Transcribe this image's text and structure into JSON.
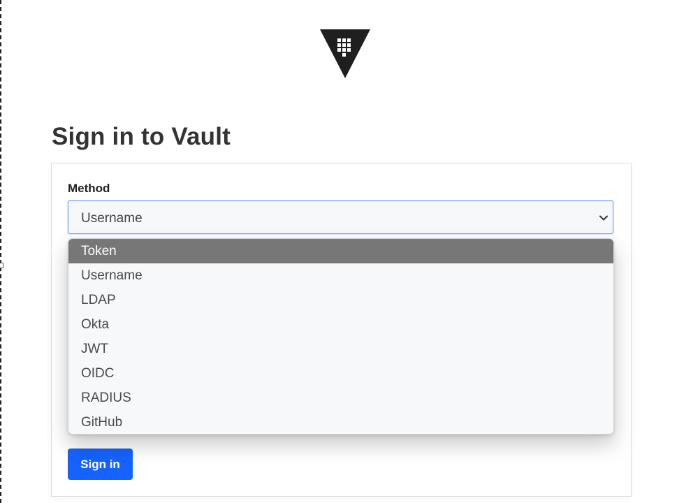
{
  "logo": {
    "icon": "vault-logo-icon",
    "color": "#1f1f1f"
  },
  "page": {
    "title": "Sign in to Vault"
  },
  "form": {
    "method_label": "Method",
    "method_select": {
      "value": "Username",
      "options": [
        {
          "label": "Token",
          "highlighted": true
        },
        {
          "label": "Username",
          "highlighted": false
        },
        {
          "label": "LDAP",
          "highlighted": false
        },
        {
          "label": "Okta",
          "highlighted": false
        },
        {
          "label": "JWT",
          "highlighted": false
        },
        {
          "label": "OIDC",
          "highlighted": false
        },
        {
          "label": "RADIUS",
          "highlighted": false
        },
        {
          "label": "GitHub",
          "highlighted": false
        }
      ]
    },
    "submit_label": "Sign in"
  },
  "colors": {
    "primary": "#1563ff",
    "focus_ring": "#6e9ff6",
    "highlight": "#777777",
    "title": "#333333"
  }
}
